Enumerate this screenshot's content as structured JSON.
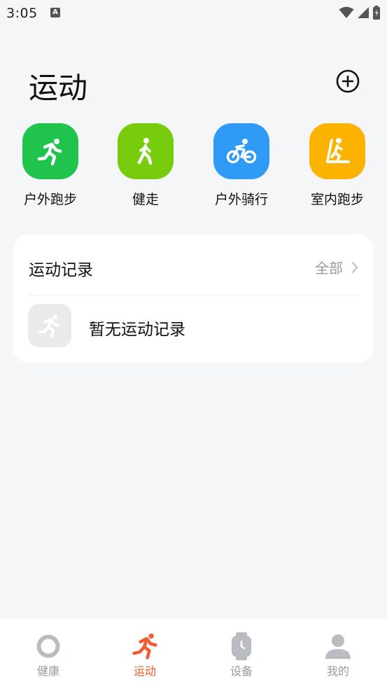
{
  "status_bar": {
    "time": "3:05",
    "notification_badge": "A"
  },
  "header": {
    "title": "运动"
  },
  "quick_sports": [
    {
      "label": "户外跑步",
      "color": "#20c44d",
      "icon": "running-icon"
    },
    {
      "label": "健走",
      "color": "#78cc0e",
      "icon": "walking-icon"
    },
    {
      "label": "户外骑行",
      "color": "#2f9bf7",
      "icon": "cycling-icon"
    },
    {
      "label": "室内跑步",
      "color": "#fbb300",
      "icon": "treadmill-icon"
    }
  ],
  "records": {
    "title": "运动记录",
    "all_label": "全部",
    "empty_text": "暂无运动记录"
  },
  "bottom_nav": [
    {
      "label": "健康",
      "icon": "ring-icon",
      "active": false
    },
    {
      "label": "运动",
      "icon": "running-icon",
      "active": true
    },
    {
      "label": "设备",
      "icon": "watch-icon",
      "active": false
    },
    {
      "label": "我的",
      "icon": "person-icon",
      "active": false
    }
  ],
  "colors": {
    "accent": "#ef5c31",
    "inactive": "#9a9a9a",
    "background": "#f5f6f8"
  }
}
